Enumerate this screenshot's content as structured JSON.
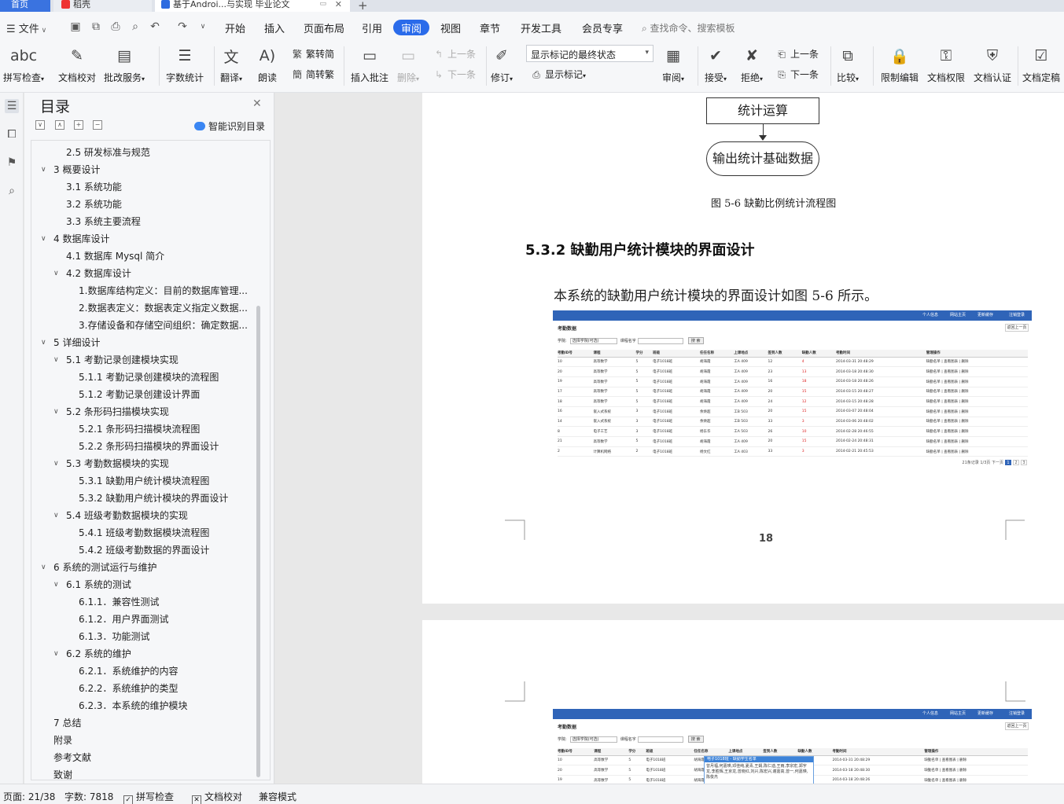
{
  "tabs": [
    {
      "label": "首页"
    },
    {
      "label": "稻壳"
    },
    {
      "label": "基于Androi...与实现 毕业论文"
    }
  ],
  "menu": {
    "file": "文件",
    "tabs": [
      "开始",
      "插入",
      "页面布局",
      "引用",
      "审阅",
      "视图",
      "章节",
      "开发工具",
      "会员专享"
    ],
    "active_tab": "审阅",
    "search_placeholder": "查找命令、搜索模板"
  },
  "ribbon": {
    "spell_check": "拼写检查",
    "doc_proofread": "文档校对",
    "batch_service": "批改服务",
    "word_count": "字数统计",
    "translate": "翻译",
    "read_aloud": "朗读",
    "to_traditional": "繁转简",
    "to_simplified": "简转繁",
    "insert_comment": "插入批注",
    "delete": "删除",
    "prev_item": "上一条",
    "next_item": "下一条",
    "track_changes": "修订",
    "markup_state": "显示标记的最终状态",
    "show_markup": "显示标记",
    "review": "审阅",
    "accept": "接受",
    "reject": "拒绝",
    "prev": "上一条",
    "next": "下一条",
    "compare": "比较",
    "restrict_edit": "限制编辑",
    "doc_permission": "文档权限",
    "doc_certify": "文档认证",
    "doc_finalize": "文档定稿"
  },
  "toc": {
    "title": "目录",
    "smart_label": "智能识别目录",
    "items": [
      {
        "text": "2.5 研发标准与规范",
        "level": 2,
        "arrow": ""
      },
      {
        "text": "3  概要设计",
        "level": 1,
        "arrow": "∨"
      },
      {
        "text": "3.1 系统功能",
        "level": 2,
        "arrow": ""
      },
      {
        "text": "3.2 系统功能",
        "level": 2,
        "arrow": ""
      },
      {
        "text": "3.3 系统主要流程",
        "level": 2,
        "arrow": ""
      },
      {
        "text": "4  数据库设计",
        "level": 1,
        "arrow": "∨"
      },
      {
        "text": "4.1  数据库 Mysql 简介",
        "level": 2,
        "arrow": ""
      },
      {
        "text": "4.2  数据库设计",
        "level": 2,
        "arrow": "∨"
      },
      {
        "text": "1.数据库结构定义：目前的数据库管理...",
        "level": 3,
        "arrow": ""
      },
      {
        "text": "2.数据表定义：数据表定义指定义数据...",
        "level": 3,
        "arrow": ""
      },
      {
        "text": "3.存储设备和存储空间组织：确定数据...",
        "level": 3,
        "arrow": ""
      },
      {
        "text": "5  详细设计",
        "level": 1,
        "arrow": "∨"
      },
      {
        "text": "5.1 考勤记录创建模块实现",
        "level": 2,
        "arrow": "∨"
      },
      {
        "text": "5.1.1 考勤记录创建模块的流程图",
        "level": 3,
        "arrow": ""
      },
      {
        "text": "5.1.2 考勤记录创建设计界面",
        "level": 3,
        "arrow": ""
      },
      {
        "text": "5.2 条形码扫描模块实现",
        "level": 2,
        "arrow": "∨"
      },
      {
        "text": "5.2.1 条形码扫描模块流程图",
        "level": 3,
        "arrow": ""
      },
      {
        "text": "5.2.2 条形码扫描模块的界面设计",
        "level": 3,
        "arrow": ""
      },
      {
        "text": "5.3 考勤数据模块的实现",
        "level": 2,
        "arrow": "∨"
      },
      {
        "text": "5.3.1 缺勤用户统计模块流程图",
        "level": 3,
        "arrow": ""
      },
      {
        "text": "5.3.2 缺勤用户统计模块的界面设计",
        "level": 3,
        "arrow": ""
      },
      {
        "text": "5.4 班级考勤数据模块的实现",
        "level": 2,
        "arrow": "∨"
      },
      {
        "text": "5.4.1 班级考勤数据模块流程图",
        "level": 3,
        "arrow": ""
      },
      {
        "text": "5.4.2 班级考勤数据的界面设计",
        "level": 3,
        "arrow": ""
      },
      {
        "text": "6  系统的测试运行与维护",
        "level": 1,
        "arrow": "∨"
      },
      {
        "text": "6.1 系统的测试",
        "level": 2,
        "arrow": "∨"
      },
      {
        "text": "6.1.1．兼容性测试",
        "level": 3,
        "arrow": ""
      },
      {
        "text": "6.1.2．用户界面测试",
        "level": 3,
        "arrow": ""
      },
      {
        "text": "6.1.3．功能测试",
        "level": 3,
        "arrow": ""
      },
      {
        "text": "6.2 系统的维护",
        "level": 2,
        "arrow": "∨"
      },
      {
        "text": "6.2.1．系统维护的内容",
        "level": 3,
        "arrow": ""
      },
      {
        "text": "6.2.2．系统维护的类型",
        "level": 3,
        "arrow": ""
      },
      {
        "text": "6.2.3．本系统的维护模块",
        "level": 3,
        "arrow": ""
      },
      {
        "text": "7  总结",
        "level": 1,
        "arrow": ""
      },
      {
        "text": "附录",
        "level": 1,
        "arrow": ""
      },
      {
        "text": "参考文献",
        "level": 1,
        "arrow": ""
      },
      {
        "text": "致谢",
        "level": 1,
        "arrow": ""
      }
    ]
  },
  "doc": {
    "flow_box": "统计运算",
    "flow_output": "输出统计基础数据",
    "figure_caption": "图 5-6  缺勤比例统计流程图",
    "section_title": "5.3.2 缺勤用户统计模块的界面设计",
    "body_text": "本系统的缺勤用户统计模块的界面设计如图 5-6 所示。",
    "page_number": "18"
  },
  "screenshot": {
    "links": [
      "个人信息",
      "网站主页",
      "更新缓存",
      "注销登录"
    ],
    "title": "考勤数据",
    "back": "返回上一页",
    "college_label": "学院:",
    "college_value": "选择学院(可选)",
    "course_label": "课程名字",
    "search_button": "搜 索",
    "headers": [
      "考勤ID号",
      "课程",
      "学分",
      "班级",
      "任任名称",
      "上课地点",
      "签到人数",
      "缺勤人数",
      "考勤时间",
      "管理操作"
    ],
    "rows": [
      [
        "10",
        "高等数学",
        "5",
        "电子1018班",
        "胡海霞",
        "工A 409",
        "12",
        "4",
        "2014-03-31 20:48:29",
        "缺勤名单 | 查看图表 | 删除"
      ],
      [
        "20",
        "高等数学",
        "5",
        "电子1018班",
        "胡海霞",
        "工A 409",
        "23",
        "13",
        "2014-03-18 20:48:30",
        "缺勤名单 | 查看图表 | 删除"
      ],
      [
        "19",
        "高等数学",
        "5",
        "电子1018班",
        "胡海霞",
        "工A 409",
        "16",
        "18",
        "2014-03-18 20:48:26",
        "缺勤名单 | 查看图表 | 删除"
      ],
      [
        "17",
        "高等数学",
        "5",
        "电子1018班",
        "胡海霞",
        "工A 409",
        "20",
        "15",
        "2014-03-15 20:48:27",
        "缺勤名单 | 查看图表 | 删除"
      ],
      [
        "18",
        "高等数学",
        "5",
        "电子1018班",
        "胡海霞",
        "工A 409",
        "24",
        "12",
        "2014-03-15 20:48:28",
        "缺勤名单 | 查看图表 | 删除"
      ],
      [
        "16",
        "嵌入式系统",
        "3",
        "电子1018班",
        "余焕超",
        "工B 503",
        "20",
        "15",
        "2014-03-07 20:48:04",
        "缺勤名单 | 查看图表 | 删除"
      ],
      [
        "14",
        "嵌入式系统",
        "3",
        "电子1018班",
        "余焕超",
        "工B 503",
        "33",
        "3",
        "2014-03-06 20:48:02",
        "缺勤名单 | 查看图表 | 删除"
      ],
      [
        "8",
        "电子工艺",
        "3",
        "电子1018班",
        "杨东华",
        "工A 503",
        "26",
        "10",
        "2014-02-28 20:46:55",
        "缺勤名单 | 查看图表 | 删除"
      ],
      [
        "21",
        "高等数学",
        "5",
        "电子1018班",
        "胡海霞",
        "工A 409",
        "20",
        "15",
        "2014-02-24 20:48:31",
        "缺勤名单 | 查看图表 | 删除"
      ],
      [
        "2",
        "计算机网络",
        "2",
        "电子1018班",
        "杨文红",
        "工A 403",
        "33",
        "3",
        "2014-02-21 20:45:53",
        "缺勤名单 | 查看图表 | 删除"
      ]
    ],
    "pager_text": "21条记录 1/3页   下一页",
    "pages": [
      "1",
      "2",
      "3"
    ],
    "popup_title": "电子1018班 - 缺勤学生名单",
    "popup_text": "曾月福,何嘉瑛,邓佳纯,夏青,王娟,陈仁迪,王雨,李宗宏,郑宇龙,李胜辉,王京龙,曾晓红,刘兴,陈宏兴,谢嘉高,曾一,何嘉瑛,陈俊杰"
  },
  "status": {
    "page": "页面: 21/38",
    "words": "字数: 7818",
    "spell": "拼写检查",
    "proof": "文档校对",
    "compat": "兼容模式"
  }
}
